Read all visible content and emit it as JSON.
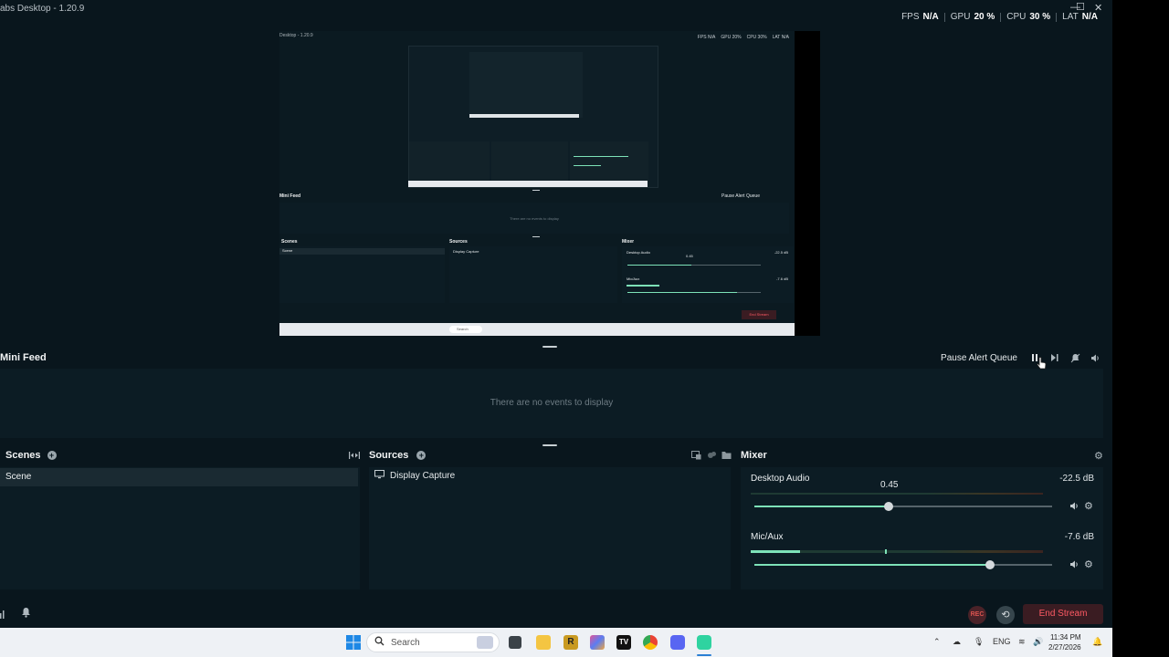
{
  "window": {
    "title": "abs Desktop - 1.20.9",
    "controls": [
      "—",
      "☐",
      "✕"
    ]
  },
  "stats": [
    {
      "label": "FPS",
      "value": "N/A"
    },
    {
      "label": "GPU",
      "value": "20 %"
    },
    {
      "label": "CPU",
      "value": "30 %"
    },
    {
      "label": "LAT",
      "value": "N/A"
    }
  ],
  "preview": {
    "title": "Desktop - 1.20.9",
    "stats": [
      "FPS N/A",
      "GPU 20%",
      "CPU 30%",
      "LAT N/A"
    ],
    "mini_feed": "Mini Feed",
    "pause_label": "Pause Alert Queue",
    "empty": "There are no events to display",
    "scenes": "Scenes",
    "scene_item": "Scene",
    "sources": "Sources",
    "source_item": "Display Capture",
    "mixer": "Mixer",
    "desktop_audio": "Desktop Audio",
    "desktop_db": "-22.5 dB",
    "desktop_val": "0.45",
    "mic": "Mic/Aux",
    "mic_db": "-7.6 dB",
    "end_stream": "End Stream",
    "search": "Search"
  },
  "mini_feed": {
    "title": "Mini Feed",
    "pause_label": "Pause Alert Queue",
    "empty_text": "There are no events to display"
  },
  "scenes": {
    "title": "Scenes",
    "items": [
      "Scene"
    ]
  },
  "sources": {
    "title": "Sources",
    "items": [
      "Display Capture"
    ]
  },
  "mixer": {
    "title": "Mixer",
    "channels": [
      {
        "name": "Desktop Audio",
        "db": "-22.5 dB",
        "value_label": "0.45",
        "volume": 0.45,
        "meter_level": 0.0
      },
      {
        "name": "Mic/Aux",
        "db": "-7.6 dB",
        "value_label": "",
        "volume": 0.79,
        "meter_level": 0.17
      }
    ]
  },
  "footer": {
    "rec_label": "REC",
    "end_stream": "End Stream"
  },
  "taskbar": {
    "search_placeholder": "Search",
    "language": "ENG",
    "time": "11:34 PM",
    "date": "2/27/2026"
  },
  "colors": {
    "background": "#09161d",
    "panel": "#0c1c24",
    "accent": "#7de2b8",
    "end_stream": "#ff5a64"
  }
}
